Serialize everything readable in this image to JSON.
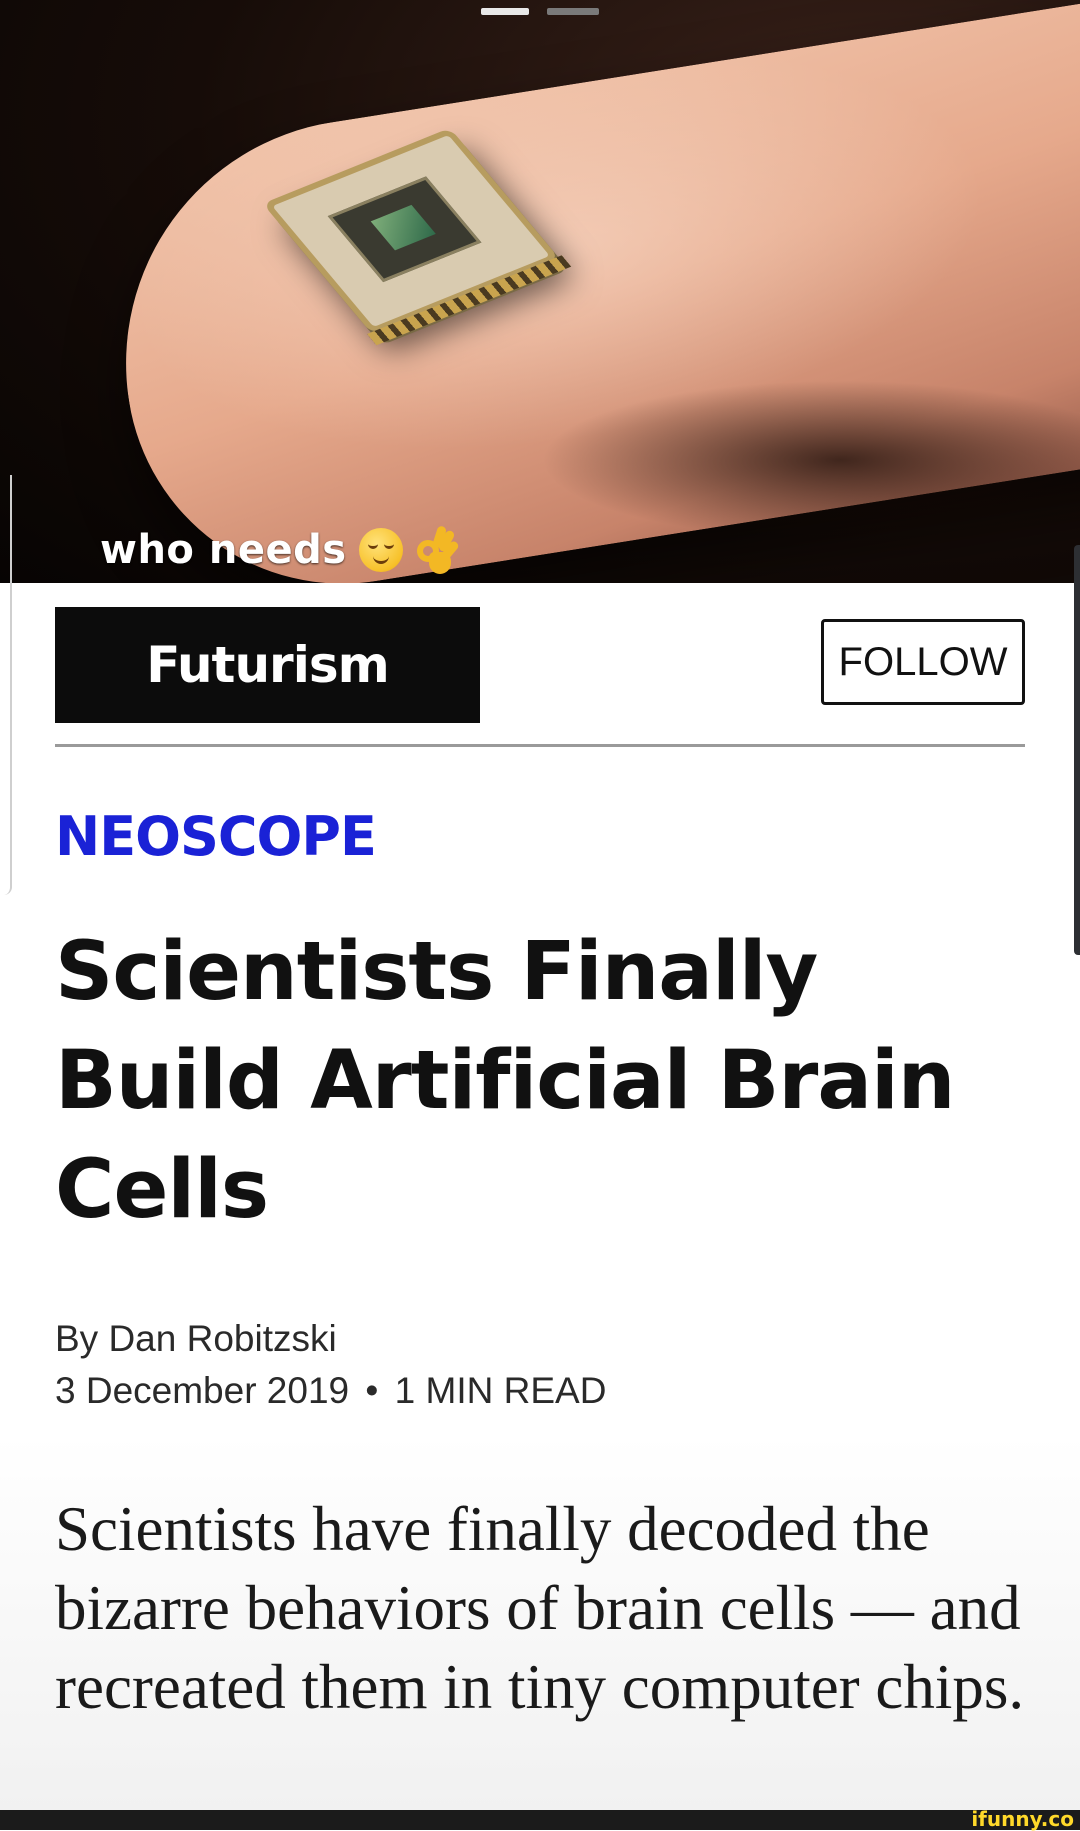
{
  "caption": {
    "text": "who needs",
    "emoji_1": "relieved-face-emoji",
    "emoji_2": "ok-hand-emoji"
  },
  "publisher": {
    "logo_text": "Futurism",
    "follow_label": "FOLLOW"
  },
  "article": {
    "category": "NEOSCOPE",
    "headline": "Scientists Finally Build Artificial Brain Cells",
    "byline": "By Dan Robitzski",
    "date": "3 December 2019",
    "separator": "•",
    "read_time": "1 MIN READ",
    "summary": "Scientists have finally decoded the bizarre behaviors of brain cells — and recreated them in tiny computer chips."
  },
  "watermark": "ifunny.co",
  "colors": {
    "category": "#1a22d6",
    "logo_bg": "#0c0c0c",
    "watermark": "#ffd92a"
  }
}
